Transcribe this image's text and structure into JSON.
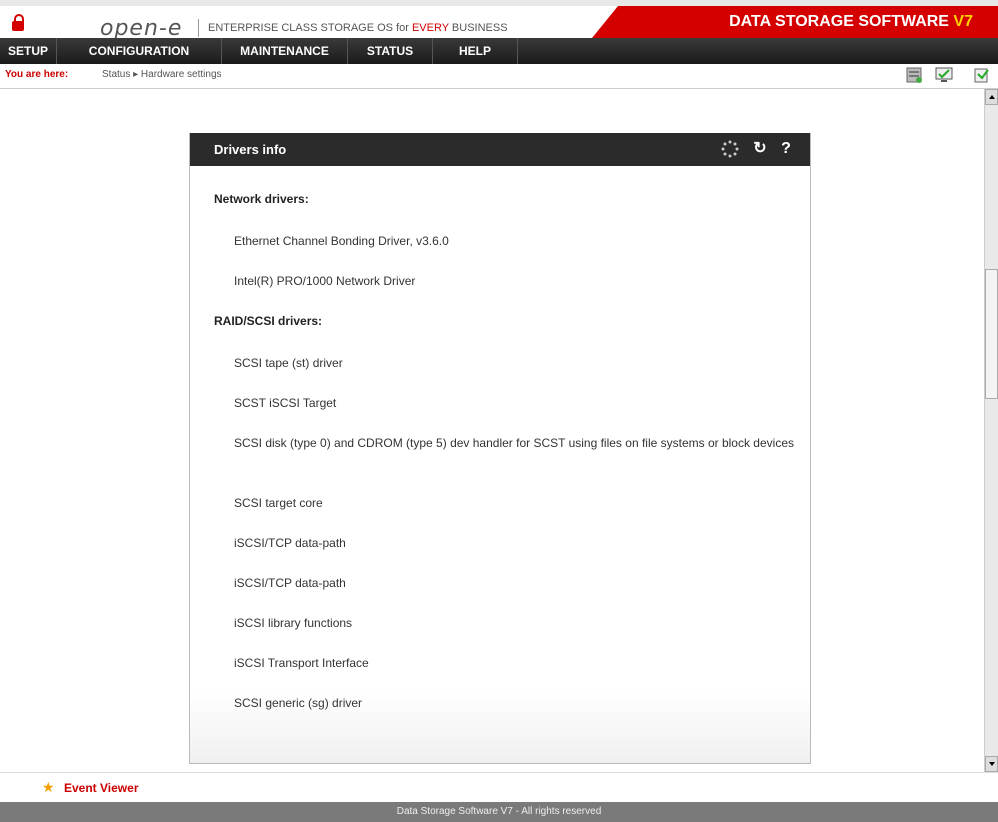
{
  "header": {
    "logo": "open-e",
    "tagline_prefix": "ENTERPRISE CLASS STORAGE OS for ",
    "tagline_highlight": "EVERY",
    "tagline_suffix": " BUSINESS",
    "brand_main": "DATA STORAGE SOFTWARE ",
    "brand_version": "V7"
  },
  "menu": {
    "items": [
      {
        "label": "SETUP"
      },
      {
        "label": "CONFIGURATION"
      },
      {
        "label": "MAINTENANCE"
      },
      {
        "label": "STATUS"
      },
      {
        "label": "HELP"
      }
    ]
  },
  "breadcrumb": {
    "label": "You are here:",
    "path": "Status ▸ Hardware settings"
  },
  "panel": {
    "title": "Drivers info",
    "sections": [
      {
        "title": "Network drivers:",
        "drivers": [
          "Ethernet Channel Bonding Driver, v3.6.0",
          "Intel(R) PRO/1000 Network Driver"
        ]
      },
      {
        "title": "RAID/SCSI drivers:",
        "drivers": [
          "SCSI tape (st) driver",
          "SCST iSCSI Target",
          "SCSI disk (type 0) and CDROM (type 5) dev handler for SCST using files on file systems or block devices",
          "SCSI target core",
          "iSCSI/TCP data-path",
          "iSCSI/TCP data-path",
          "iSCSI library functions",
          "iSCSI Transport Interface",
          "SCSI generic (sg) driver"
        ]
      }
    ]
  },
  "event_viewer": {
    "label": "Event Viewer"
  },
  "footer": {
    "text": "Data Storage Software V7 - All rights reserved"
  },
  "colors": {
    "brand_red": "#d40000",
    "accent_yellow": "#ffd200",
    "panel_head": "#2b2b2b"
  }
}
